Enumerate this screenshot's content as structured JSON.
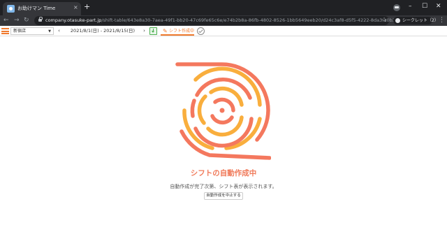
{
  "browser": {
    "tab_title": "お助けマン Time",
    "tab_close": "×",
    "new_tab": "+",
    "url_host": "company.otasuke-part.jp",
    "url_path": "/shift-table/643e8a30-7aea-49f1-bb20-47c69fe65c6e/e74b2b8a-86fb-4802-8526-1bb5649eeb20/d24c3af8-d5f5-4222-8da3-a0b2c90f1c37",
    "incognito_label": "シークレット（2）",
    "back": "←",
    "forward": "→",
    "reload": "↻",
    "star": "☆",
    "menu": "⋮",
    "minimize": "–",
    "maximize": "☐",
    "close": "✕"
  },
  "appbar": {
    "store_name": "新宿店",
    "store_caret": "▼",
    "prev": "‹",
    "next": "›",
    "date_range": "2021/8/1(日) - 2021/8/15(日)",
    "auto_create_label": "シフト作成中",
    "pencil": "✎"
  },
  "main": {
    "status_title": "シフトの自動作成中",
    "status_description": "自動作成が完了次第、シフト表が表示されます。",
    "cancel_label": "自動作成を中止する"
  },
  "colors": {
    "accent_orange": "#f07a2e",
    "spinner_salmon": "#f4785e",
    "spinner_gold": "#f9ae3d",
    "chrome_dark": "#202124",
    "chrome_mid": "#35363a"
  }
}
